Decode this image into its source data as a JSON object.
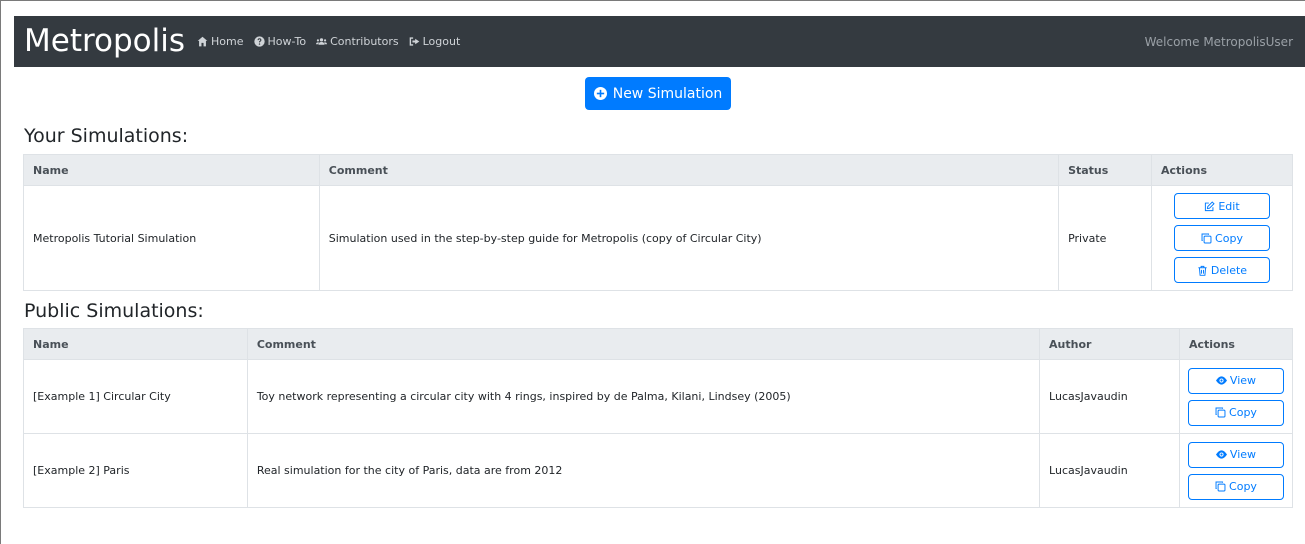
{
  "nav": {
    "brand": "Metropolis",
    "links": [
      {
        "label": "Home",
        "icon": "home-icon"
      },
      {
        "label": "How-To",
        "icon": "question-circle-icon"
      },
      {
        "label": "Contributors",
        "icon": "users-icon"
      },
      {
        "label": "Logout",
        "icon": "sign-out-icon"
      }
    ],
    "welcome": "Welcome MetropolisUser"
  },
  "new_simulation_label": "New Simulation",
  "your_simulations": {
    "title": "Your Simulations:",
    "headers": {
      "name": "Name",
      "comment": "Comment",
      "status": "Status",
      "actions": "Actions"
    },
    "rows": [
      {
        "name": "Metropolis Tutorial Simulation",
        "comment": "Simulation used in the step-by-step guide for Metropolis (copy of Circular City)",
        "status": "Private",
        "edit": "Edit",
        "copy": "Copy",
        "delete": "Delete"
      }
    ]
  },
  "public_simulations": {
    "title": "Public Simulations:",
    "headers": {
      "name": "Name",
      "comment": "Comment",
      "author": "Author",
      "actions": "Actions"
    },
    "rows": [
      {
        "name": "[Example 1] Circular City",
        "comment": "Toy network representing a circular city with 4 rings, inspired by de Palma, Kilani, Lindsey (2005)",
        "author": "LucasJavaudin",
        "view": "View",
        "copy": "Copy"
      },
      {
        "name": "[Example 2] Paris",
        "comment": "Real simulation for the city of Paris, data are from 2012",
        "author": "LucasJavaudin",
        "view": "View",
        "copy": "Copy"
      }
    ]
  },
  "colors": {
    "primary": "#007bff",
    "navbar": "#343a40",
    "header_bg": "#e9ecef"
  }
}
